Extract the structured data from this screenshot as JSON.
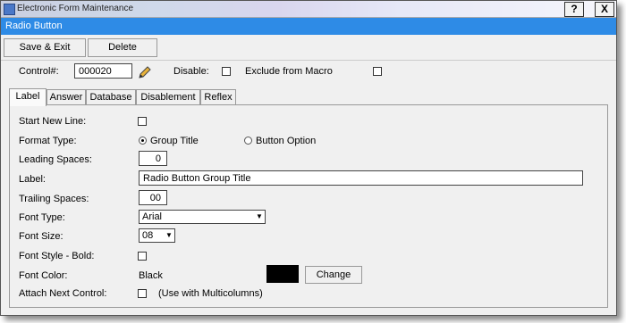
{
  "window": {
    "title": "Electronic Form Maintenance",
    "help_label": "?",
    "close_label": "X"
  },
  "form": {
    "title": "Radio Button"
  },
  "toolbar": {
    "save_exit_label": "Save & Exit",
    "delete_label": "Delete"
  },
  "header": {
    "control_label": "Control#:",
    "control_value": "000020",
    "disable_label": "Disable:",
    "disable_checked": false,
    "exclude_label": "Exclude from Macro",
    "exclude_checked": false
  },
  "tabs": [
    {
      "label": "Label",
      "active": true
    },
    {
      "label": "Answer",
      "active": false
    },
    {
      "label": "Database",
      "active": false
    },
    {
      "label": "Disablement",
      "active": false
    },
    {
      "label": "Reflex",
      "active": false
    }
  ],
  "fields": {
    "start_new_line": {
      "label": "Start New Line:",
      "checked": false
    },
    "format_type": {
      "label": "Format Type:",
      "options": [
        {
          "label": "Group Title",
          "selected": true
        },
        {
          "label": "Button Option",
          "selected": false
        }
      ]
    },
    "leading_spaces": {
      "label": "Leading Spaces:",
      "value": "0"
    },
    "label": {
      "label": "Label:",
      "value": "Radio Button Group Title"
    },
    "trailing_spaces": {
      "label": "Trailing Spaces:",
      "value": "00"
    },
    "font_type": {
      "label": "Font Type:",
      "value": "Arial"
    },
    "font_size": {
      "label": "Font Size:",
      "value": "08"
    },
    "font_style_bold": {
      "label": "Font Style - Bold:",
      "checked": false
    },
    "font_color": {
      "label": "Font Color:",
      "value": "Black",
      "swatch": "#000000",
      "change_label": "Change"
    },
    "attach_next": {
      "label": "Attach Next Control:",
      "checked": false,
      "note": "(Use with Multicolumns)"
    }
  },
  "colors": {
    "form_bar": "#2e8be6",
    "window_bg": "#f0f0f0"
  }
}
